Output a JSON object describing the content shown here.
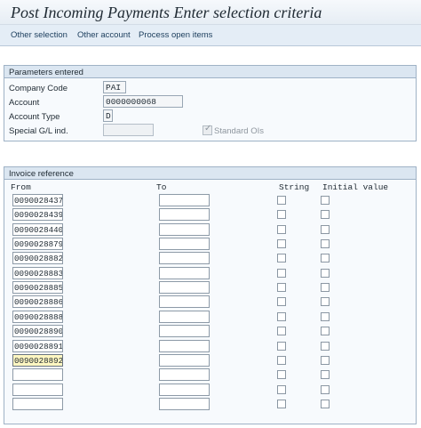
{
  "window": {
    "title": "Post Incoming Payments Enter selection criteria"
  },
  "toolbar": {
    "other_selection": "Other selection",
    "other_account": "Other account",
    "process_open_items": "Process open items"
  },
  "parameters": {
    "title": "Parameters entered",
    "company_code": {
      "label": "Company Code",
      "value": "PAI"
    },
    "account": {
      "label": "Account",
      "value": "0000000068"
    },
    "account_type": {
      "label": "Account Type",
      "value": "D"
    },
    "special_gl": {
      "label": "Special G/L ind.",
      "value": ""
    },
    "standard_ois": {
      "label": "Standard OIs",
      "checked": true,
      "enabled": false
    }
  },
  "invoice_reference": {
    "title": "Invoice reference",
    "columns": {
      "from": "From",
      "to": "To",
      "string": "String",
      "initial_value": "Initial value"
    },
    "rows": [
      {
        "from": "0090028437",
        "to": ""
      },
      {
        "from": "0090028439",
        "to": ""
      },
      {
        "from": "0090028440",
        "to": ""
      },
      {
        "from": "0090028879",
        "to": ""
      },
      {
        "from": "0090028882",
        "to": ""
      },
      {
        "from": "0090028883",
        "to": ""
      },
      {
        "from": "0090028885",
        "to": ""
      },
      {
        "from": "0090028886",
        "to": ""
      },
      {
        "from": "0090028888",
        "to": ""
      },
      {
        "from": "0090028890",
        "to": ""
      },
      {
        "from": "0090028891",
        "to": ""
      },
      {
        "from": "0090028892",
        "to": ""
      },
      {
        "from": "",
        "to": ""
      },
      {
        "from": "",
        "to": ""
      },
      {
        "from": "",
        "to": ""
      }
    ],
    "focused_row": 11
  },
  "colors": {
    "accent": "#dbe6f1",
    "toolbar": "#e4edf6",
    "focus": "#fff7c2",
    "border": "#9fb2c6"
  }
}
